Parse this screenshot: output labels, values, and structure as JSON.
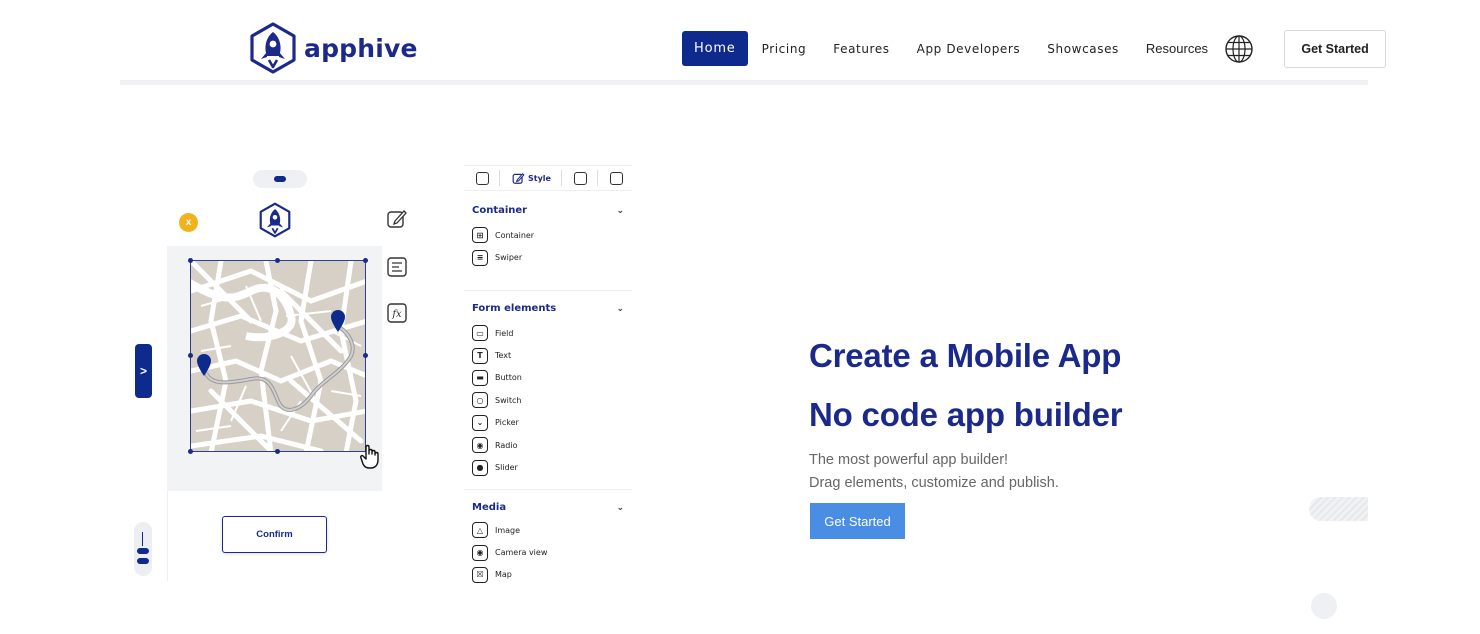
{
  "brand": {
    "name": "apphive"
  },
  "nav": {
    "items": [
      "Home",
      "Pricing",
      "Features",
      "App Developers",
      "Showcases",
      "Resources"
    ],
    "get_started": "Get Started"
  },
  "builder": {
    "close_label": "x",
    "tab_arrow": ">",
    "confirm_label": "Confirm",
    "panel_style_tab": "Style",
    "sections": [
      {
        "title": "Container",
        "items": [
          "Container",
          "Swiper"
        ]
      },
      {
        "title": "Form elements",
        "items": [
          "Field",
          "Text",
          "Button",
          "Switch",
          "Picker",
          "Radio",
          "Slider"
        ]
      },
      {
        "title": "Media",
        "items": [
          "Image",
          "Camera view",
          "Map"
        ]
      }
    ]
  },
  "hero": {
    "title_line1": "Create a Mobile App",
    "title_line2": "No code app builder",
    "subtitle_line1": "The most powerful app builder!",
    "subtitle_line2": "Drag elements, customize and publish.",
    "cta": "Get Started"
  },
  "colors": {
    "brand_navy": "#0d2a8c",
    "cta_blue": "#4a8ee3",
    "accent_yellow": "#f2b21e"
  }
}
